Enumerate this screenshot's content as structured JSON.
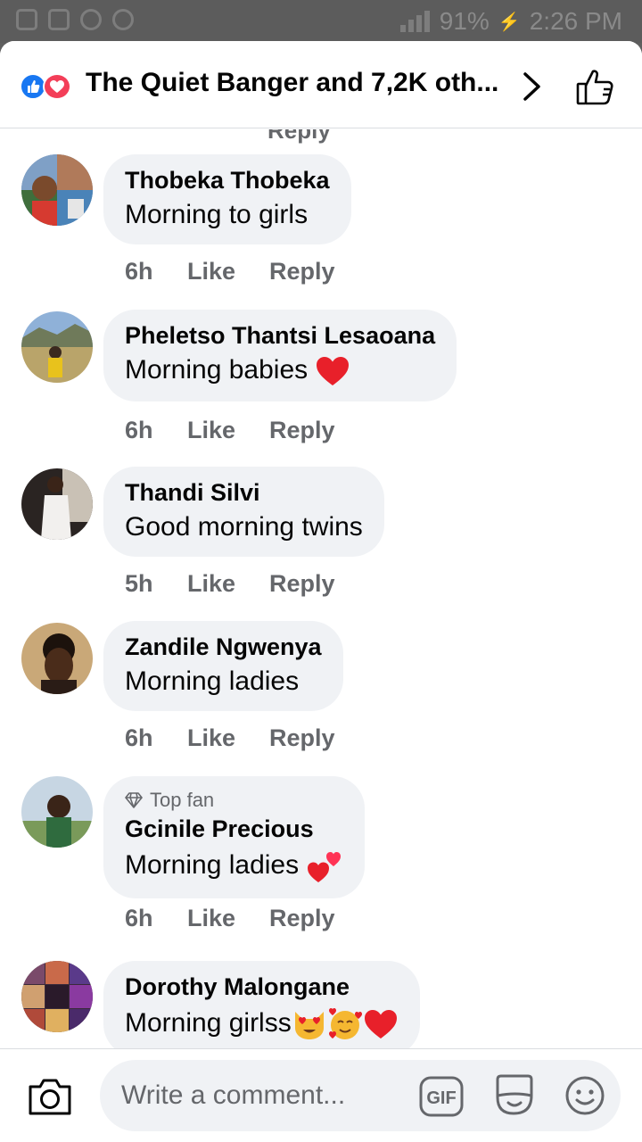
{
  "status_bar": {
    "battery": "91%",
    "time": "2:26 PM"
  },
  "header": {
    "title": "The Quiet Banger and 7,2K oth..."
  },
  "comments": [
    {
      "name": "Thobeka Thobeka",
      "text": "Morning to girls",
      "time": "6h",
      "like": "Like",
      "reply": "Reply",
      "badge": ""
    },
    {
      "name": "Pheletso Thantsi Lesaoana",
      "text": "Morning babies",
      "time": "6h",
      "like": "Like",
      "reply": "Reply",
      "badge": ""
    },
    {
      "name": "Thandi Silvi",
      "text": "Good morning twins",
      "time": "5h",
      "like": "Like",
      "reply": "Reply",
      "badge": ""
    },
    {
      "name": "Zandile Ngwenya",
      "text": "Morning ladies",
      "time": "6h",
      "like": "Like",
      "reply": "Reply",
      "badge": ""
    },
    {
      "name": "Gcinile Precious",
      "text": "Morning ladies",
      "time": "6h",
      "like": "Like",
      "reply": "Reply",
      "badge": "Top fan"
    },
    {
      "name": "Dorothy Malongane",
      "text": "Morning girlss",
      "time": "",
      "like": "",
      "reply": "",
      "badge": ""
    }
  ],
  "previous_reply": "Reply",
  "footer": {
    "placeholder": "Write a comment...",
    "gif_label": "GIF"
  },
  "colors": {
    "facebook_blue": "#1877f2",
    "love_red": "#f33e58",
    "bubble_grey": "#f0f2f5",
    "meta_grey": "#65676b"
  },
  "icons": [
    "like-reaction-icon",
    "love-reaction-icon",
    "chevron-right-icon",
    "thumbs-up-icon",
    "camera-icon",
    "gif-icon",
    "sticker-icon",
    "emoji-icon",
    "diamond-icon",
    "heart-emoji",
    "two-hearts-emoji",
    "heart-eyes-cat-emoji",
    "smiling-hearts-emoji"
  ]
}
